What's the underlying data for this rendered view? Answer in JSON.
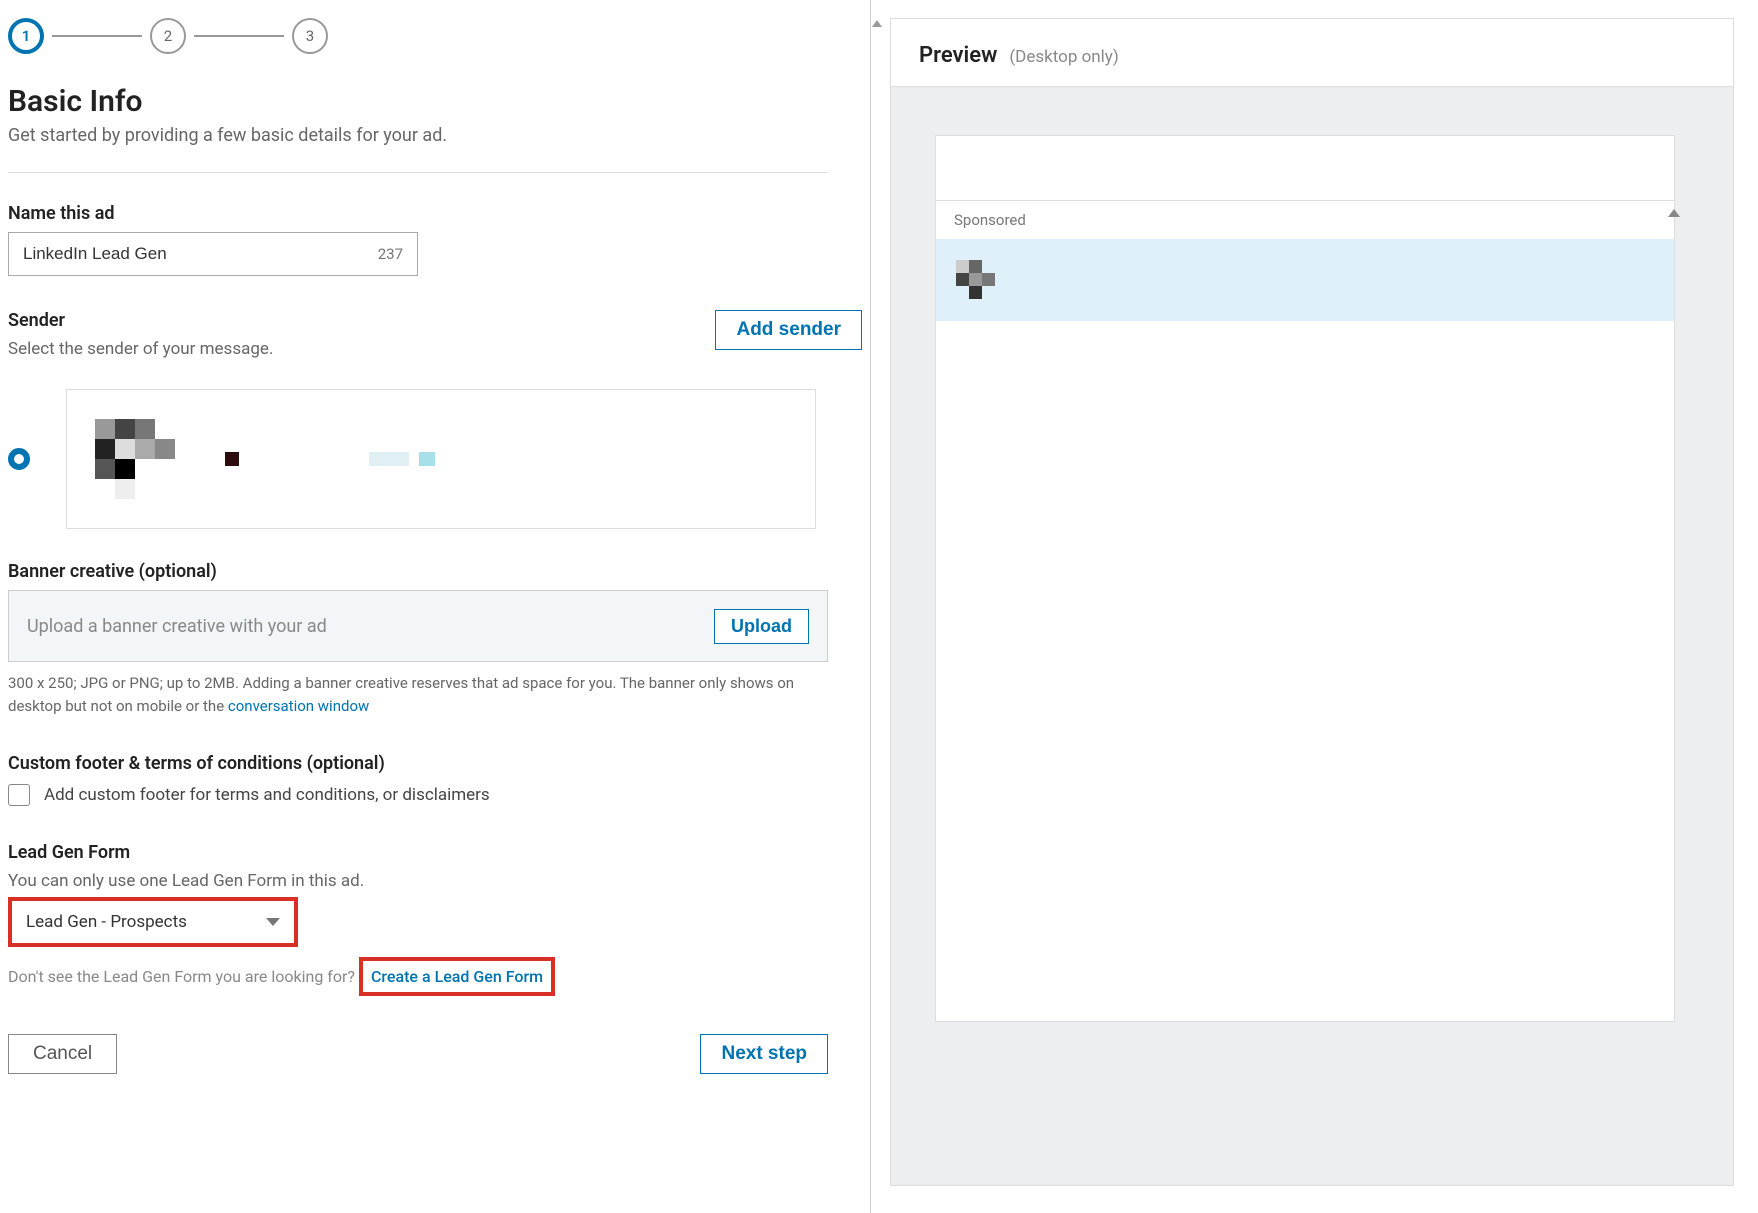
{
  "stepper": {
    "steps": [
      "1",
      "2",
      "3"
    ],
    "active_index": 0
  },
  "page": {
    "title": "Basic Info",
    "subtitle": "Get started by providing a few basic details for your ad."
  },
  "adName": {
    "label": "Name this ad",
    "value": "LinkedIn Lead Gen",
    "remaining": "237"
  },
  "sender": {
    "label": "Sender",
    "sublabel": "Select the sender of your message.",
    "addButton": "Add sender"
  },
  "banner": {
    "label": "Banner creative (optional)",
    "placeholder": "Upload a banner creative with your ad",
    "uploadButton": "Upload",
    "helperPrefix": "300 x 250; JPG or PNG; up to 2MB. Adding a banner creative reserves that ad space for you. The banner only shows on desktop but not on mobile or the ",
    "helperLink": "conversation window"
  },
  "footer": {
    "label": "Custom footer & terms of conditions (optional)",
    "checkboxLabel": "Add custom footer for terms and conditions, or disclaimers"
  },
  "leadGen": {
    "label": "Lead Gen Form",
    "sublabel": "You can only use one Lead Gen Form in this ad.",
    "selected": "Lead Gen - Prospects",
    "notePrefix": "Don't see the Lead Gen Form you are looking for?",
    "linkText": "Create a Lead Gen Form"
  },
  "buttons": {
    "cancel": "Cancel",
    "next": "Next step"
  },
  "preview": {
    "title": "Preview",
    "sub": "(Desktop only)",
    "sponsored": "Sponsored"
  }
}
